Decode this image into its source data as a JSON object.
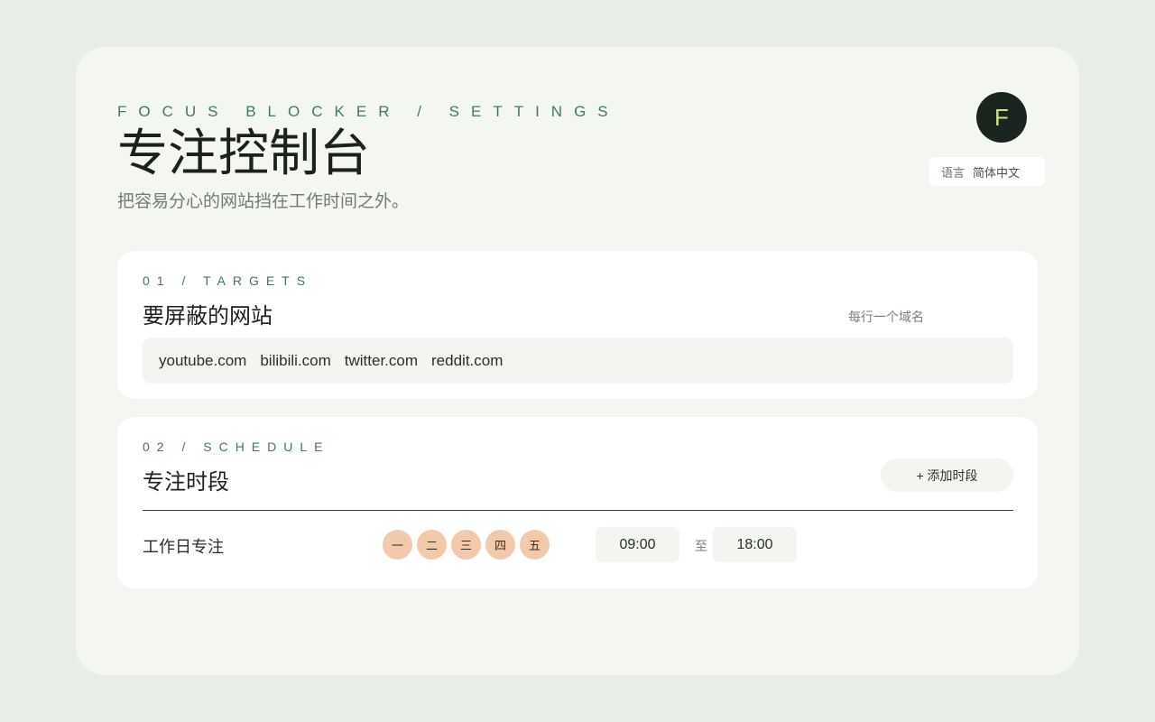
{
  "header": {
    "eyebrow": "FOCUS BLOCKER / SETTINGS",
    "title": "专注控制台",
    "subtitle": "把容易分心的网站挡在工作时间之外。"
  },
  "avatar": {
    "initial": "F",
    "bg_color": "#1b2520",
    "text_color": "#c9e48c"
  },
  "language": {
    "label": "语言",
    "value": "简体中文"
  },
  "targets": {
    "eyebrow": "01 / TARGETS",
    "title": "要屏蔽的网站",
    "hint": "每行一个域名",
    "domains": [
      "youtube.com",
      "bilibili.com",
      "twitter.com",
      "reddit.com"
    ]
  },
  "schedule": {
    "eyebrow": "02 / SCHEDULE",
    "title": "专注时段",
    "add_button": "+ 添加时段",
    "rules": [
      {
        "name": "工作日专注",
        "days": [
          "一",
          "二",
          "三",
          "四",
          "五"
        ],
        "start": "09:00",
        "to_label": "至",
        "end": "18:00"
      }
    ]
  },
  "colors": {
    "accent": "#3f7a5c",
    "day_chip": "#f3c9ab",
    "background": "#e8ede8",
    "panel": "#f3f6f1"
  }
}
